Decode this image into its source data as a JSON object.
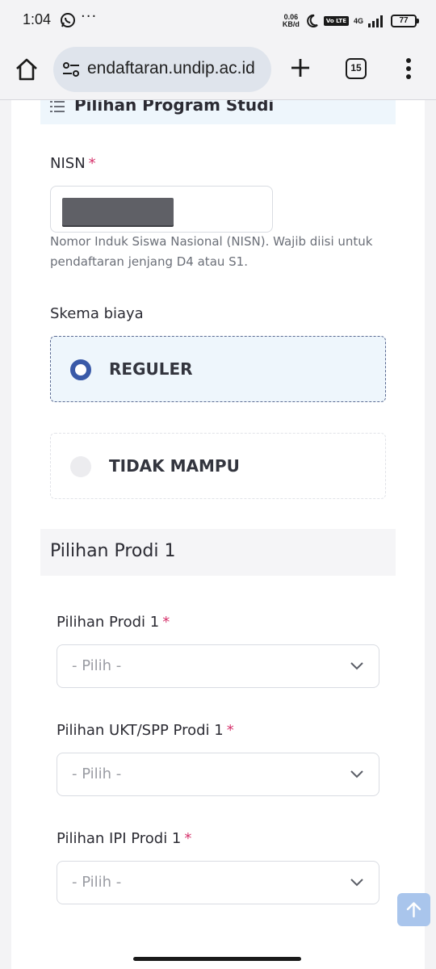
{
  "status": {
    "time": "1:04",
    "more": "···",
    "speed_top": "0.06",
    "speed_bottom": "KB/d",
    "volte": "Vo LTE",
    "network": "4G",
    "battery": "77"
  },
  "browser": {
    "url": "endaftaran.undip.ac.id",
    "tab_count": "15"
  },
  "form": {
    "section_title": "Pilihan Program Studi",
    "nisn": {
      "label": "NISN",
      "required": "*",
      "help": "Nomor Induk Siswa Nasional (NISN). Wajib diisi untuk pendaftaran jenjang D4 atau S1."
    },
    "skema": {
      "label": "Skema biaya",
      "options": [
        {
          "label": "REGULER",
          "selected": true
        },
        {
          "label": "TIDAK MAMPU",
          "selected": false
        }
      ]
    },
    "prodi_section_title": "Pilihan Prodi 1",
    "fields": [
      {
        "label": "Pilihan Prodi 1",
        "required": "*",
        "placeholder": "- Pilih -"
      },
      {
        "label": "Pilihan UKT/SPP Prodi 1",
        "required": "*",
        "placeholder": "- Pilih -"
      },
      {
        "label": "Pilihan IPI Prodi 1",
        "required": "*",
        "placeholder": "- Pilih -"
      }
    ]
  },
  "colors": {
    "accent": "#3a5aa8",
    "required": "#d6336c",
    "selected_bg": "#eef6fc"
  }
}
